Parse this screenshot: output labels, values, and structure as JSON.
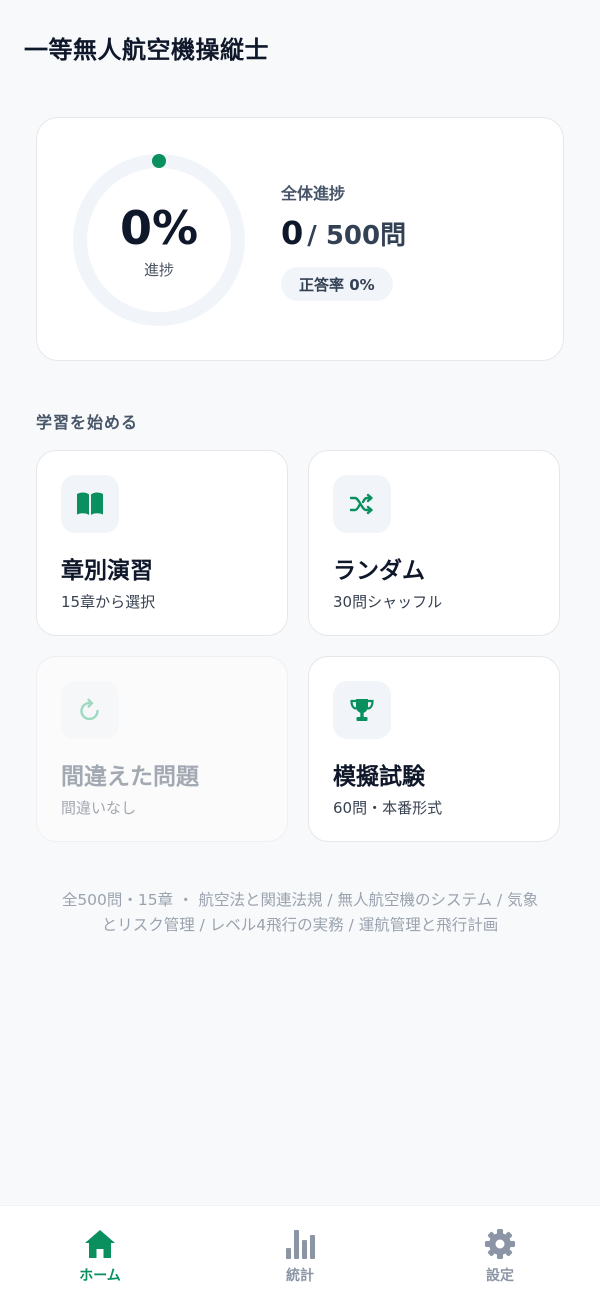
{
  "app": {
    "title": "一等無人航空機操縦士"
  },
  "progress": {
    "percent_text": "0%",
    "percent_value": 0,
    "caption": "進捗",
    "overall_label": "全体進捗",
    "answered": "0",
    "total_text": "/ 500問",
    "accuracy_text": "正答率 0%"
  },
  "section": {
    "heading": "学習を始める"
  },
  "cards": [
    {
      "title": "章別演習",
      "subtitle": "15章から選択",
      "icon": "open-book-icon",
      "enabled": true
    },
    {
      "title": "ランダム",
      "subtitle": "30問シャッフル",
      "icon": "shuffle-icon",
      "enabled": true
    },
    {
      "title": "間違えた問題",
      "subtitle": "間違いなし",
      "icon": "refresh-icon",
      "enabled": false
    },
    {
      "title": "模擬試験",
      "subtitle": "60問・本番形式",
      "icon": "trophy-icon",
      "enabled": true
    }
  ],
  "footer": {
    "line1": "全500問・15章 ・ 航空法と関連法規 / 無人航空機のシステム / 気象",
    "line2": "とリスク管理 / レベル4飛行の実務 / 運航管理と飛行計画"
  },
  "nav": [
    {
      "label": "ホーム",
      "icon": "home-icon",
      "active": true
    },
    {
      "label": "統計",
      "icon": "bar-chart-icon",
      "active": false
    },
    {
      "label": "設定",
      "icon": "gear-icon",
      "active": false
    }
  ],
  "colors": {
    "accent": "#0a8f5f",
    "ring_track": "#f1f5f9",
    "inactive": "#8b95a5",
    "disabled_icon": "#9fd9c0"
  }
}
